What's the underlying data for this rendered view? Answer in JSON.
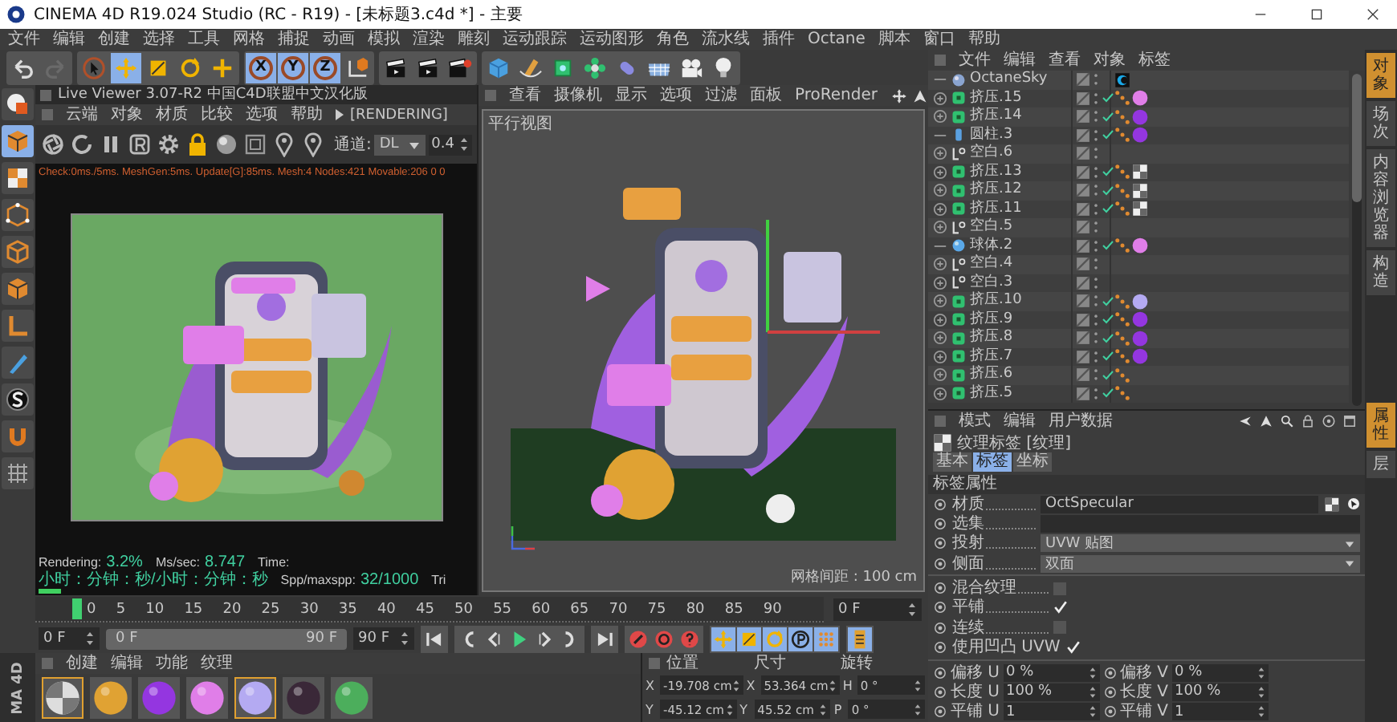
{
  "window": {
    "title": "CINEMA 4D R19.024 Studio (RC - R19) - [未标题3.c4d *] - 主要"
  },
  "menu_bar": [
    "文件",
    "编辑",
    "创建",
    "选择",
    "工具",
    "网格",
    "捕捉",
    "动画",
    "模拟",
    "渲染",
    "雕刻",
    "运动跟踪",
    "运动图形",
    "角色",
    "流水线",
    "插件",
    "Octane",
    "脚本",
    "窗口",
    "帮助"
  ],
  "toolbar": {
    "mode_tools": [
      {
        "selected": false
      },
      {
        "selected": true
      },
      {
        "selected": false
      },
      {
        "selected": false
      },
      {
        "selected": false
      }
    ],
    "axes": [
      {
        "label": "X",
        "selected": true
      },
      {
        "label": "Y",
        "selected": true
      },
      {
        "label": "Z",
        "selected": true
      }
    ]
  },
  "live_viewer": {
    "title": "Live Viewer 3.07-R2 中国C4D联盟中文汉化版",
    "menu": [
      "云端",
      "对象",
      "材质",
      "比较",
      "选项",
      "帮助"
    ],
    "status_tag": "[RENDERING]",
    "channel_label": "通道:",
    "channel_value": "DL",
    "value": "0.4",
    "stats_line": "Check:0ms./5ms. MeshGen:5ms. Update[G]:85ms. Mesh:4 Nodes:421 Movable:206  0 0",
    "footer": [
      {
        "label": "Rendering:",
        "value": "3.2%"
      },
      {
        "label": "Ms/sec:",
        "value": "8.747"
      },
      {
        "label": "Time:",
        "value": "小时：分钟：秒/小时：分钟：秒"
      },
      {
        "label": "Spp/maxspp:",
        "value": "32/1000"
      }
    ],
    "footer_tail": "Tri",
    "progress": {
      "level": 0.05
    }
  },
  "viewport": {
    "menu": [
      "查看",
      "摄像机",
      "显示",
      "选项",
      "过滤",
      "面板",
      "ProRender"
    ],
    "label": "平行视图",
    "grid_info": "网格间距 : 100 cm"
  },
  "timeline": {
    "ticks": [
      "0",
      "5",
      "10",
      "15",
      "20",
      "25",
      "30",
      "35",
      "40",
      "45",
      "50",
      "55",
      "60",
      "65",
      "70",
      "75",
      "80",
      "85",
      "90"
    ],
    "level": 0,
    "current_frame": "0 F"
  },
  "playback": {
    "start": "0 F",
    "range_start": "0 F",
    "range_end": "90 F",
    "end": "90 F",
    "range": {
      "level": 1
    }
  },
  "logo_text": "MA 4D",
  "materials": {
    "menu": [
      "创建",
      "编辑",
      "功能",
      "纹理"
    ],
    "items": [
      {
        "kind": "checker",
        "selected": true
      },
      {
        "kind": "ball",
        "color": "#e0a233",
        "selected": false
      },
      {
        "kind": "ball",
        "color": "#9436e0",
        "selected": false
      },
      {
        "kind": "ball",
        "color": "#e07ee8",
        "selected": false
      },
      {
        "kind": "ball",
        "color": "#b4aaf2",
        "selected": true
      },
      {
        "kind": "ball",
        "color": "#3a2838",
        "selected": false
      },
      {
        "kind": "ball",
        "color": "#4cae5c",
        "selected": false
      }
    ]
  },
  "coordinates": {
    "headers": [
      "位置",
      "尺寸",
      "旋转"
    ],
    "rows": [
      {
        "axis": "X",
        "position": "-19.708 cm",
        "size_axis": "X",
        "size": "53.364 cm",
        "rot_axis": "H",
        "rotation": "0 °"
      },
      {
        "axis": "Y",
        "position": "-45.12 cm",
        "size_axis": "Y",
        "size": "45.52 cm",
        "rot_axis": "P",
        "rotation": "0 °"
      }
    ]
  },
  "object_manager": {
    "menu": [
      "文件",
      "编辑",
      "查看",
      "对象",
      "标签"
    ],
    "objects": [
      {
        "name": "OctaneSky",
        "kind": "sky",
        "expandable": false,
        "enabled": false,
        "tags": [
          {
            "kind": "environment"
          }
        ]
      },
      {
        "name": "挤压.15",
        "kind": "extrude",
        "expandable": true,
        "enabled": true,
        "tags": [
          {
            "kind": "phong"
          },
          {
            "kind": "material",
            "color": "#e07ee8"
          }
        ]
      },
      {
        "name": "挤压.14",
        "kind": "extrude",
        "expandable": true,
        "enabled": true,
        "tags": [
          {
            "kind": "phong"
          },
          {
            "kind": "material",
            "color": "#9436e0"
          }
        ]
      },
      {
        "name": "圆柱.3",
        "kind": "cylinder",
        "expandable": false,
        "enabled": true,
        "tags": [
          {
            "kind": "phong"
          },
          {
            "kind": "material",
            "color": "#9436e0"
          }
        ]
      },
      {
        "name": "空白.6",
        "kind": "null",
        "expandable": true,
        "enabled": false
      },
      {
        "name": "挤压.13",
        "kind": "extrude",
        "expandable": true,
        "enabled": true,
        "tags": [
          {
            "kind": "phong"
          },
          {
            "kind": "checker"
          }
        ]
      },
      {
        "name": "挤压.12",
        "kind": "extrude",
        "expandable": true,
        "enabled": true,
        "tags": [
          {
            "kind": "phong"
          },
          {
            "kind": "checker"
          }
        ]
      },
      {
        "name": "挤压.11",
        "kind": "extrude",
        "expandable": true,
        "enabled": true,
        "tags": [
          {
            "kind": "phong"
          },
          {
            "kind": "checker"
          }
        ]
      },
      {
        "name": "空白.5",
        "kind": "null",
        "expandable": true,
        "enabled": false
      },
      {
        "name": "球体.2",
        "kind": "sphere",
        "expandable": false,
        "enabled": true,
        "tags": [
          {
            "kind": "phong"
          },
          {
            "kind": "material",
            "color": "#e07ee8"
          }
        ]
      },
      {
        "name": "空白.4",
        "kind": "null",
        "expandable": true,
        "enabled": false
      },
      {
        "name": "空白.3",
        "kind": "null",
        "expandable": true,
        "enabled": false
      },
      {
        "name": "挤压.10",
        "kind": "extrude",
        "expandable": true,
        "enabled": true,
        "tags": [
          {
            "kind": "phong"
          },
          {
            "kind": "material",
            "color": "#b4aaf2"
          }
        ]
      },
      {
        "name": "挤压.9",
        "kind": "extrude",
        "expandable": true,
        "enabled": true,
        "tags": [
          {
            "kind": "phong"
          },
          {
            "kind": "material",
            "color": "#9436e0"
          }
        ]
      },
      {
        "name": "挤压.8",
        "kind": "extrude",
        "expandable": true,
        "enabled": true,
        "tags": [
          {
            "kind": "phong"
          },
          {
            "kind": "material",
            "color": "#9436e0"
          }
        ]
      },
      {
        "name": "挤压.7",
        "kind": "extrude",
        "expandable": true,
        "enabled": true,
        "tags": [
          {
            "kind": "phong"
          },
          {
            "kind": "material",
            "color": "#9436e0"
          }
        ]
      },
      {
        "name": "挤压.6",
        "kind": "extrude",
        "expandable": true,
        "enabled": true,
        "tags": [
          {
            "kind": "phong"
          }
        ]
      },
      {
        "name": "挤压.5",
        "kind": "extrude",
        "expandable": true,
        "enabled": true,
        "tags": [
          {
            "kind": "phong"
          }
        ]
      }
    ]
  },
  "attributes": {
    "menu": [
      "模式",
      "编辑",
      "用户数据"
    ],
    "title": "纹理标签 [纹理]",
    "tabs": [
      {
        "label": "基本",
        "selected": false
      },
      {
        "label": "标签",
        "selected": true
      },
      {
        "label": "坐标",
        "selected": false
      }
    ],
    "section": "标签属性",
    "fields": [
      {
        "kind": "link",
        "label": "材质",
        "value": "OctSpecular"
      },
      {
        "kind": "text",
        "label": "选集"
      },
      {
        "kind": "dropdown",
        "label": "投射",
        "value": "UVW 贴图"
      },
      {
        "kind": "dropdown",
        "label": "侧面",
        "value": "双面"
      }
    ],
    "options": [
      {
        "label": "混合纹理",
        "checked": false
      },
      {
        "label": "平铺",
        "checked": true
      },
      {
        "label": "连续",
        "checked": false
      },
      {
        "label": "使用凹凸 UVW",
        "checked": true
      }
    ],
    "pairs": [
      {
        "label_u": "偏移 U",
        "value_u": "0 %",
        "label_v": "偏移 V",
        "value_v": "0 %"
      },
      {
        "label_u": "长度 U",
        "value_u": "100 %",
        "label_v": "长度 V",
        "value_v": "100 %"
      },
      {
        "label_u": "平铺 U",
        "value_u": "1",
        "label_v": "平铺 V",
        "value_v": "1"
      }
    ]
  },
  "side_tabs_top": [
    {
      "label": "对象",
      "selected": true
    },
    {
      "label": "场次",
      "selected": false
    },
    {
      "label": "内容浏览器",
      "selected": false
    },
    {
      "label": "构造",
      "selected": false
    }
  ],
  "side_tabs_bottom": [
    {
      "label": "属性",
      "selected": true
    },
    {
      "label": "层",
      "selected": false
    }
  ]
}
